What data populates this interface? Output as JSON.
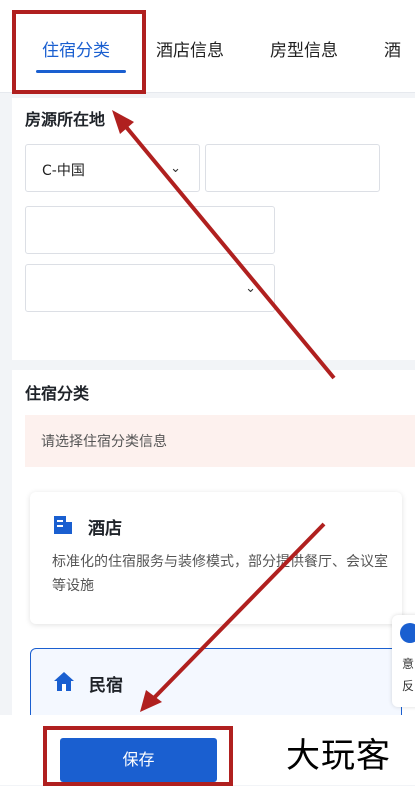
{
  "tabs": [
    {
      "label": "住宿分类",
      "active": true
    },
    {
      "label": "酒店信息",
      "active": false
    },
    {
      "label": "房型信息",
      "active": false
    },
    {
      "label": "酒",
      "active": false
    }
  ],
  "location": {
    "section_title": "房源所在地",
    "country_value": "C-中国"
  },
  "category": {
    "section_title": "住宿分类",
    "notice": "请选择住宿分类信息",
    "options": [
      {
        "title": "酒店",
        "desc": "标准化的住宿服务与装修模式，部分提供餐厅、会议室等设施",
        "icon": "hotel-building-icon"
      },
      {
        "title": "民宿",
        "desc": "",
        "icon": "home-icon"
      }
    ]
  },
  "side_widget": {
    "line1": "意",
    "line2": "反"
  },
  "footer": {
    "save_label": "保存"
  },
  "watermark": "大玩客",
  "colors": {
    "accent": "#1a5fd0",
    "annotation": "#b0201f",
    "notice_bg": "#fdf1ee"
  }
}
